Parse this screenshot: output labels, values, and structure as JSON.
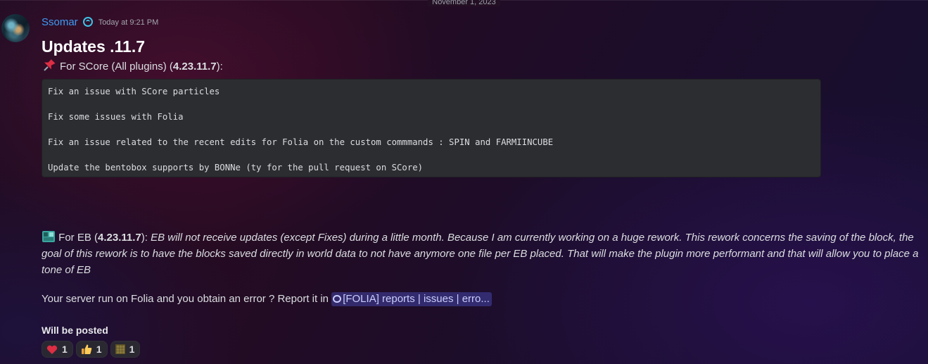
{
  "date_divider": "November 1, 2023",
  "message": {
    "author": "Ssomar",
    "timestamp": "Today at 9:21 PM",
    "title": "Updates .11.7",
    "score_section": {
      "prefix": "For SCore (All plugins) (",
      "version": "4.23.11.7",
      "suffix": "):"
    },
    "code_lines": [
      "Fix an issue with SCore particles",
      "Fix some issues with Folia",
      "Fix an issue related to the recent edits for Folia on the custom commmands : SPIN and FARMIINCUBE",
      "Update the bentobox supports by BONNe (ty for the pull request on SCore)"
    ],
    "eb_section": {
      "prefix": "For EB (",
      "version": "4.23.11.7",
      "suffix": "): ",
      "italic_text": "EB will not receive updates (except Fixes) during a little month. Because I am currently working on a huge rework. This rework concerns the saving of the block, the goal of this rework is to have the blocks saved directly in world data to not have anymore one file per EB placed. That will make the  plugin more performant and that will allow you to place a tone of EB"
    },
    "report_text": "Your server run on Folia and you obtain an error ? Report it in ",
    "channel_mention": "[FOLIA] reports | issues | erro...",
    "posted_label": "Will be posted",
    "reactions": [
      {
        "emoji": "heart-icon",
        "count": "1"
      },
      {
        "emoji": "thumbs-up-icon",
        "count": "1"
      },
      {
        "emoji": "block-icon",
        "count": "1"
      }
    ]
  },
  "colors": {
    "username": "#3e9cf5",
    "mention_bg": "#5865f2",
    "code_bg": "#2b2d31"
  }
}
